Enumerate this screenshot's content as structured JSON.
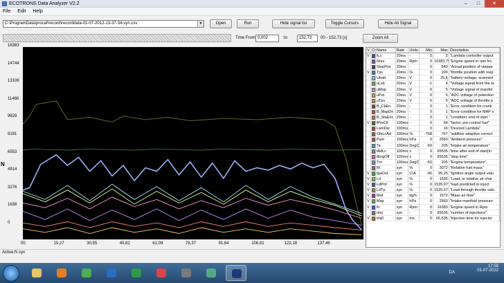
{
  "window": {
    "title": "ECOTRONS Data Analyzer V2.2",
    "minimize": "–",
    "maximize": "□",
    "close": "✕"
  },
  "menu": [
    "File",
    "Edit",
    "Help"
  ],
  "toolbar": {
    "file_path": "C:\\ProgramData\\procaf\\record\\recorddata-01-07-2012-13-37-34-syn.csv",
    "open": "Open",
    "run": "Run",
    "hide_signal_list": "Hide signal list",
    "toggle_cursors": "Toggle Cursors",
    "hide_all_signal": "Hide All Signal"
  },
  "timebar": {
    "time_from_label": "Time From:",
    "time_from": "0,002",
    "to_label": "to",
    "time_to": "152,73",
    "range_text": "00 - 152,73 [s]",
    "zoom_all": "Zoom All"
  },
  "chart": {
    "ylabel": "N",
    "y_ticks": [
      "16383",
      "14744",
      "13106",
      "11468",
      "9829",
      "8191",
      "6553",
      "4914",
      "3276",
      "1638",
      "0"
    ],
    "x_ticks": [
      "00",
      "15,27",
      "30,55",
      "45,82",
      "61,09",
      "76,37",
      "91,64",
      "106,91",
      "122,18",
      "137,46"
    ]
  },
  "chart_data": {
    "type": "line",
    "title": "",
    "xlabel": "",
    "ylabel": "N",
    "xlim": [
      0,
      152.73
    ],
    "ylim": [
      0,
      16383
    ],
    "grid": false,
    "series": [
      {
        "color": "#5b7a2e",
        "x": [
          0,
          3,
          6,
          15,
          20,
          30,
          40,
          45,
          55,
          65,
          75,
          90,
          105,
          120,
          135,
          140,
          145,
          150,
          152
        ],
        "y": [
          9829,
          10500,
          11500,
          11800,
          10200,
          10400,
          10000,
          10500,
          10200,
          10400,
          10100,
          10300,
          10200,
          10400,
          10200,
          9600,
          6800,
          2600,
          1200
        ]
      },
      {
        "color": "#9ab0ff",
        "x": [
          0,
          3,
          8,
          15,
          20,
          25,
          30,
          35,
          40,
          45,
          50,
          55,
          60,
          65,
          70,
          75,
          80,
          85,
          90,
          95,
          100,
          105,
          110,
          115,
          120,
          125,
          130,
          135,
          140,
          145,
          148,
          152
        ],
        "y": [
          4200,
          4400,
          6400,
          7200,
          6300,
          7000,
          5800,
          6700,
          5400,
          6300,
          5000,
          6100,
          5800,
          6800,
          5500,
          6600,
          5300,
          6500,
          5200,
          6700,
          5800,
          6100,
          5900,
          6300,
          6000,
          6500,
          6100,
          6400,
          5200,
          2500,
          1600,
          800
        ]
      },
      {
        "color": "#2e7a3a",
        "x": [
          0,
          5,
          10,
          20,
          30,
          40,
          50,
          60,
          70,
          80,
          90,
          100,
          110,
          120,
          130,
          140,
          152
        ],
        "y": [
          7600,
          7700,
          7650,
          7600,
          7700,
          7650,
          7600,
          7700,
          7650,
          7600,
          7700,
          7650,
          7600,
          7700,
          7650,
          7600,
          7650
        ]
      },
      {
        "color": "#ff9ad6",
        "x": [
          0,
          10,
          20,
          30,
          40,
          50,
          60,
          70,
          80,
          90,
          100,
          110,
          120,
          130,
          140,
          152
        ],
        "y": [
          3100,
          2700,
          3500,
          2600,
          3600,
          2800,
          3400,
          2600,
          3300,
          2700,
          3500,
          2900,
          3400,
          3000,
          2500,
          1800
        ]
      },
      {
        "color": "#a8e8ff",
        "x": [
          0,
          10,
          20,
          30,
          40,
          50,
          60,
          70,
          80,
          90,
          100,
          110,
          120,
          130,
          140,
          152
        ],
        "y": [
          4100,
          3400,
          4600,
          3300,
          4700,
          3400,
          4500,
          3300,
          4400,
          3200,
          4600,
          3400,
          4500,
          3600,
          3000,
          2200
        ]
      },
      {
        "color": "#e8ff9a",
        "x": [
          0,
          10,
          20,
          30,
          40,
          50,
          60,
          70,
          80,
          90,
          100,
          110,
          120,
          130,
          140,
          152
        ],
        "y": [
          3900,
          3200,
          4200,
          3100,
          4300,
          3000,
          4100,
          3100,
          4000,
          3000,
          4200,
          3200,
          4100,
          3400,
          2900,
          2000
        ]
      },
      {
        "color": "#c28bff",
        "x": [
          0,
          10,
          20,
          30,
          40,
          50,
          60,
          70,
          80,
          90,
          100,
          110,
          120,
          130,
          140,
          152
        ],
        "y": [
          2400,
          1700,
          2600,
          1600,
          2500,
          1700,
          2600,
          1600,
          2500,
          1700,
          2600,
          1800,
          2500,
          1900,
          1600,
          1200
        ]
      },
      {
        "color": "#ff8080",
        "x": [
          0,
          10,
          20,
          30,
          40,
          50,
          60,
          70,
          80,
          90,
          100,
          110,
          120,
          130,
          140,
          152
        ],
        "y": [
          1400,
          1100,
          1500,
          1000,
          1500,
          1100,
          1400,
          1000,
          1500,
          1100,
          1500,
          1100,
          1400,
          1200,
          1000,
          800
        ]
      },
      {
        "color": "#ffcf6b",
        "x": [
          0,
          10,
          20,
          30,
          40,
          50,
          60,
          70,
          80,
          90,
          100,
          110,
          120,
          130,
          140,
          152
        ],
        "y": [
          900,
          600,
          1000,
          500,
          1000,
          600,
          900,
          500,
          1000,
          600,
          900,
          600,
          900,
          700,
          500,
          400
        ]
      }
    ]
  },
  "table": {
    "headers": [
      "V",
      "Cc",
      "Name",
      "Rate",
      "Units",
      "Min",
      "Max",
      "Description"
    ],
    "rows": [
      {
        "v": "V",
        "color": "#2255cc",
        "name": "fLc",
        "rate": "20ms",
        "units": "-",
        "min": "0",
        "max": "2",
        "desc": "\"Lambda controller output"
      },
      {
        "v": "",
        "color": "#8844aa",
        "name": "Nrev",
        "rate": "20ms",
        "units": "Rpm",
        "min": "0",
        "max": "16383,75",
        "desc": "\"Engine speed in rpm fro"
      },
      {
        "v": "",
        "color": "#444444",
        "name": "StepPos",
        "rate": "20ms",
        "units": "-",
        "min": "0",
        "max": "640",
        "desc": "\"Actual position of steppe"
      },
      {
        "v": "V",
        "color": "#4477dd",
        "name": "Tps",
        "rate": "20ms",
        "units": "%",
        "min": "0",
        "max": "100",
        "desc": "\"throttle position with resp"
      },
      {
        "v": "",
        "color": "#77ccee",
        "name": "Ubatt",
        "rate": "20ms",
        "units": "V",
        "min": "0",
        "max": "25,6",
        "desc": "\"battery-voltage, scanned"
      },
      {
        "v": "",
        "color": "#66aa66",
        "name": "uLsb",
        "rate": "20ms",
        "units": "V",
        "min": "-1",
        "max": "4",
        "desc": "\"Voltage signal from the la"
      },
      {
        "v": "",
        "color": "#cc99cc",
        "name": "uMap",
        "rate": "20ms",
        "units": "V",
        "min": "0",
        "max": "5",
        "desc": "\"Voltage signal of manifol"
      },
      {
        "v": "",
        "color": "#ccaa55",
        "name": "uPot",
        "rate": "20ms",
        "units": "V",
        "min": "0",
        "max": "5",
        "desc": "\"ADC-voltage of potention"
      },
      {
        "v": "",
        "color": "#dd8833",
        "name": "uTps",
        "rate": "20ms",
        "units": "V",
        "min": "0",
        "max": "5",
        "desc": "\"ADC-voltage of throttle p"
      },
      {
        "v": "",
        "color": "#993333",
        "name": "B_CkEn",
        "rate": "20ms",
        "units": "-",
        "min": "0",
        "max": "1",
        "desc": "\"Error condition for crank"
      },
      {
        "v": "",
        "color": "#cc4444",
        "name": "B_MapDn",
        "rate": "20ms",
        "units": "-",
        "min": "0",
        "max": "1",
        "desc": "\"Error condition for MAP s"
      },
      {
        "v": "",
        "color": "#bb7755",
        "name": "B_StaEnc",
        "rate": "20ms",
        "units": "-",
        "min": "0",
        "max": "1",
        "desc": "\"condition: end of start \""
      },
      {
        "v": "V",
        "color": "#556633",
        "name": "fPreCtl",
        "rate": "100ms",
        "units": "-",
        "min": "0",
        "max": "64",
        "desc": "\"factor, pre-control fuel\""
      },
      {
        "v": "",
        "color": "#cc3333",
        "name": "LamDsr",
        "rate": "100ms",
        "units": "-",
        "min": "0",
        "max": "16",
        "desc": "\"Desired Lambda\""
      },
      {
        "v": "",
        "color": "#996633",
        "name": "OfsLcAd",
        "rate": "100ms",
        "units": "%",
        "min": "-768",
        "max": "767",
        "desc": "\"additive adaptive correct"
      },
      {
        "v": "",
        "color": "#aa5555",
        "name": "Pam",
        "rate": "100ms",
        "units": "hPa",
        "min": "0",
        "max": "2560",
        "desc": "\"Ambient pressure\""
      },
      {
        "v": "",
        "color": "#33aacc",
        "name": "Ta",
        "rate": "100ms",
        "units": "DegC",
        "min": "-50",
        "max": "205",
        "desc": "\"Intake air temperature\""
      },
      {
        "v": "",
        "color": "#888888",
        "name": "tAdLc",
        "rate": "100ms",
        "units": "s",
        "min": "0",
        "max": "65535",
        "desc": "\"time after end of start(in"
      },
      {
        "v": "",
        "color": "#cc66aa",
        "name": "tEngOff",
        "rate": "100ms",
        "units": "s",
        "min": "0",
        "max": "65535",
        "desc": "\"stop time\""
      },
      {
        "v": "",
        "color": "#6699cc",
        "name": "Tm",
        "rate": "100ms",
        "units": "DegC",
        "min": "-50",
        "max": "205",
        "desc": "\"Engine temperature\""
      },
      {
        "v": "",
        "color": "#996699",
        "name": "Rl",
        "rate": "syn",
        "units": "%",
        "min": "0",
        "max": "3072",
        "desc": "\"Relative fuel mass\""
      },
      {
        "v": "V",
        "color": "#44aa44",
        "name": "IgaOut",
        "rate": "syn",
        "units": "CrA",
        "min": "-96",
        "max": "95,25",
        "desc": "\"Ignition angle output valu"
      },
      {
        "v": "V",
        "color": "#88cc44",
        "name": "Ld",
        "rate": "syn",
        "units": "%",
        "min": "0",
        "max": "1536",
        "desc": "\"Load, or relative air char"
      },
      {
        "v": "V",
        "color": "#2266aa",
        "name": "LdPrd",
        "rate": "syn",
        "units": "%",
        "min": "0",
        "max": "1535,977",
        "desc": "\"load predicted to inject"
      },
      {
        "v": "V",
        "color": "#aa8833",
        "name": "LdTp",
        "rate": "syn",
        "units": "%",
        "min": "0",
        "max": "1535,977",
        "desc": "\"Load through throttle valu"
      },
      {
        "v": "V",
        "color": "#993399",
        "name": "Maf",
        "rate": "syn",
        "units": "kg/h",
        "min": "0",
        "max": "1572",
        "desc": "\"Mass air flow\""
      },
      {
        "v": "V",
        "color": "#55bb55",
        "name": "Map",
        "rate": "syn",
        "units": "hPa",
        "min": "0",
        "max": "2560",
        "desc": "\"Intake manifold pressure"
      },
      {
        "v": "V",
        "color": "#3355ff",
        "name": "N",
        "rate": "syn",
        "units": "Rpm",
        "min": "0",
        "max": "16383",
        "desc": "\"Engine speed in Rpm"
      },
      {
        "v": "",
        "color": "#777777",
        "name": "nInj",
        "rate": "syn",
        "units": "-",
        "min": "0",
        "max": "65535",
        "desc": "\"number of injections\""
      },
      {
        "v": "V",
        "color": "#cc6600",
        "name": "tInj0",
        "rate": "syn",
        "units": "ms",
        "min": "0",
        "max": "65,535",
        "desc": "\"injection time for injector"
      }
    ]
  },
  "status": {
    "text": "Active:N syn"
  },
  "taskbar": {
    "icons": [
      "explorer-icon",
      "media-player-icon",
      "chrome-icon",
      "word-icon",
      "excel-icon",
      "paint-icon",
      "app-icon",
      "tool-icon",
      "ecotrons-icon"
    ],
    "lang": "DA",
    "time": "17:59",
    "date": "01-07-2012"
  }
}
